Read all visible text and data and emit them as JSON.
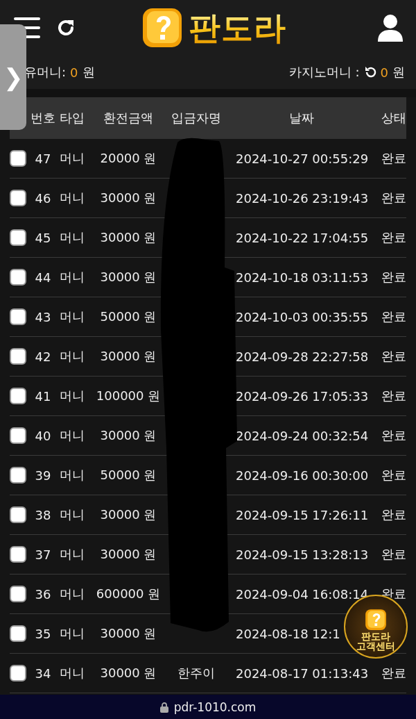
{
  "header": {
    "logo_text": "판도라"
  },
  "side_tab": {
    "label": "❯"
  },
  "balances": {
    "left": {
      "label": "유머니:",
      "value": "0",
      "unit": "원"
    },
    "right": {
      "label": "카지노머니 :",
      "value": "0",
      "unit": "원"
    }
  },
  "table": {
    "columns": [
      "번호",
      "타입",
      "환전금액",
      "입금자명",
      "날짜",
      "상태"
    ],
    "rows": [
      {
        "checked": false,
        "no": "47",
        "type": "머니",
        "amount": "20000 원",
        "date": "2024-10-27 00:55:29",
        "status": "완료"
      },
      {
        "checked": false,
        "no": "46",
        "type": "머니",
        "amount": "30000 원",
        "date": "2024-10-26 23:19:43",
        "status": "완료"
      },
      {
        "checked": false,
        "no": "45",
        "type": "머니",
        "amount": "30000 원",
        "date": "2024-10-22 17:04:55",
        "status": "완료"
      },
      {
        "checked": false,
        "no": "44",
        "type": "머니",
        "amount": "30000 원",
        "date": "2024-10-18 03:11:53",
        "status": "완료"
      },
      {
        "checked": false,
        "no": "43",
        "type": "머니",
        "amount": "50000 원",
        "date": "2024-10-03 00:35:55",
        "status": "완료"
      },
      {
        "checked": false,
        "no": "42",
        "type": "머니",
        "amount": "30000 원",
        "date": "2024-09-28 22:27:58",
        "status": "완료"
      },
      {
        "checked": false,
        "no": "41",
        "type": "머니",
        "amount": "100000 원",
        "date": "2024-09-26 17:05:33",
        "status": "완료"
      },
      {
        "checked": false,
        "no": "40",
        "type": "머니",
        "amount": "30000 원",
        "date": "2024-09-24 00:32:54",
        "status": "완료"
      },
      {
        "checked": false,
        "no": "39",
        "type": "머니",
        "amount": "50000 원",
        "date": "2024-09-16 00:30:00",
        "status": "완료"
      },
      {
        "checked": false,
        "no": "38",
        "type": "머니",
        "amount": "30000 원",
        "date": "2024-09-15 17:26:11",
        "status": "완료"
      },
      {
        "checked": false,
        "no": "37",
        "type": "머니",
        "amount": "30000 원",
        "date": "2024-09-15 13:28:13",
        "status": "완료"
      },
      {
        "checked": false,
        "no": "36",
        "type": "머니",
        "amount": "600000 원",
        "date": "2024-09-04 16:08:14",
        "status": "완료"
      },
      {
        "checked": false,
        "no": "35",
        "type": "머니",
        "amount": "30000 원",
        "date": "2024-08-18 12:1"
      },
      {
        "checked": false,
        "no": "34",
        "type": "머니",
        "amount": "30000 원",
        "name": "한주이",
        "date": "2024-08-17 01:13:43",
        "status": "완료"
      }
    ]
  },
  "support_badge": {
    "line1": "판도라",
    "line2": "고객센터"
  },
  "address_bar": {
    "url": "pdr-1010.com"
  }
}
